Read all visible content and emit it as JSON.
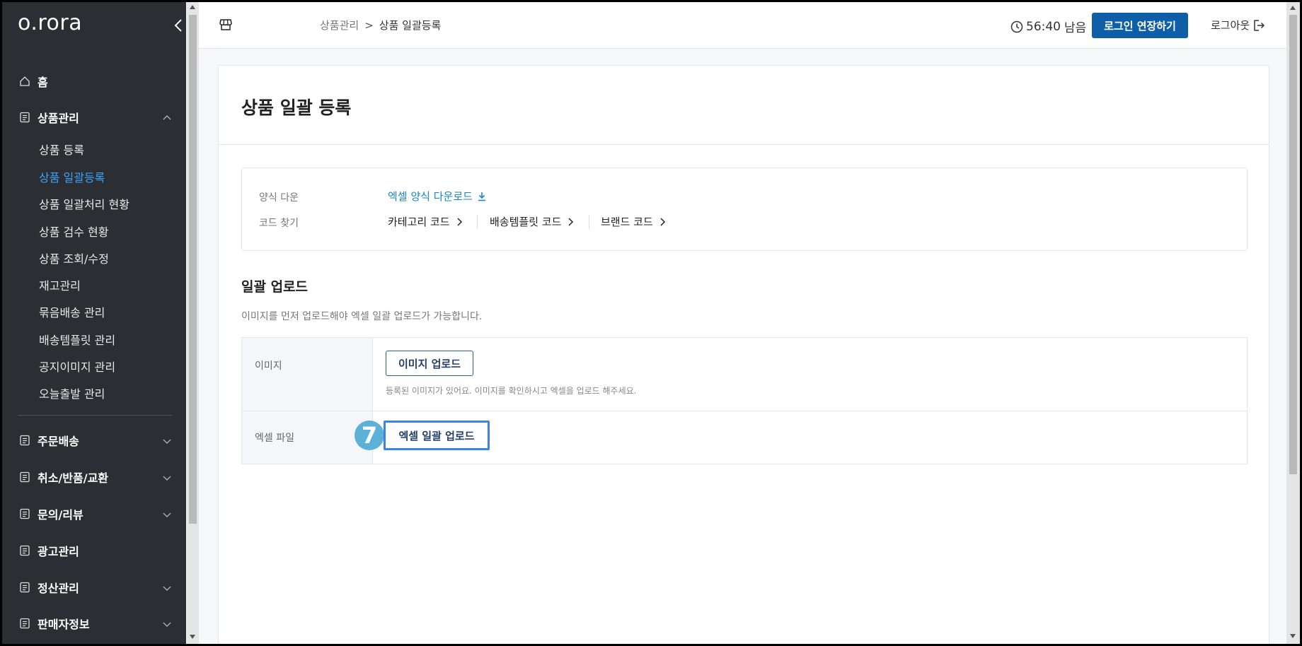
{
  "sidebar": {
    "logo": "o.rora",
    "home": "홈",
    "product_mgmt": "상품관리",
    "product_sub": [
      {
        "label": "상품 등록",
        "active": false
      },
      {
        "label": "상품 일괄등록",
        "active": true
      },
      {
        "label": "상품 일괄처리 현황",
        "active": false
      },
      {
        "label": "상품 검수 현황",
        "active": false
      },
      {
        "label": "상품 조회/수정",
        "active": false
      },
      {
        "label": "재고관리",
        "active": false
      },
      {
        "label": "묶음배송 관리",
        "active": false
      },
      {
        "label": "배송템플릿 관리",
        "active": false
      },
      {
        "label": "공지이미지 관리",
        "active": false
      },
      {
        "label": "오늘출발 관리",
        "active": false
      }
    ],
    "groups": [
      "주문배송",
      "취소/반품/교환",
      "문의/리뷰",
      "광고관리",
      "정산관리",
      "판매자정보"
    ],
    "active_color": "#3da1f5"
  },
  "header": {
    "breadcrumb_parent": "상품관리",
    "breadcrumb_sep": ">",
    "breadcrumb_current": "상품 일괄등록",
    "timer_time": "56:40",
    "timer_suffix": "남음",
    "extend_label": "로그인 연장하기",
    "logout_label": "로그아웃",
    "brand_color": "#0f5ea8"
  },
  "main": {
    "title": "상품 일괄 등록",
    "template_label": "양식 다운",
    "template_link": "엑셀 양식 다운로드",
    "code_label": "코드 찾기",
    "code_links": [
      "카테고리 코드",
      "배송템플릿 코드",
      "브랜드 코드"
    ],
    "upload_title": "일괄 업로드",
    "upload_desc": "이미지를 먼저 업로드해야 엑셀 일괄 업로드가 가능합니다.",
    "image_row_label": "이미지",
    "image_upload_btn": "이미지 업로드",
    "image_note": "등록된 이미지가 있어요. 이미지를 확인하시고 엑셀을 업로드 해주세요.",
    "excel_row_label": "엑셀 파일",
    "excel_upload_btn": "엑셀 일괄 업로드",
    "step_badge": "7",
    "highlight_color": "#3b84e0"
  }
}
